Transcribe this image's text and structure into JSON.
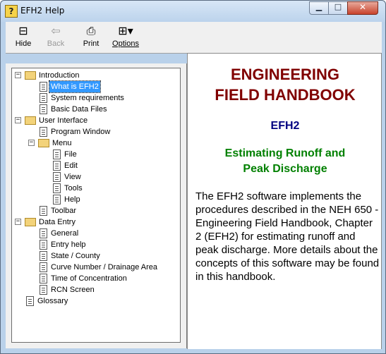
{
  "window": {
    "title": "EFH2 Help"
  },
  "toolbar": {
    "buttons": [
      {
        "label": "Hide",
        "icon": "hide-icon",
        "enabled": true
      },
      {
        "label": "Back",
        "icon": "back-arrow-icon",
        "enabled": false
      },
      {
        "label": "Print",
        "icon": "printer-icon",
        "enabled": true
      },
      {
        "label": "Options",
        "icon": "options-icon",
        "enabled": true
      }
    ]
  },
  "tree": {
    "nodes": [
      {
        "label": "Introduction",
        "type": "folder",
        "expanded": true,
        "level": 0
      },
      {
        "label": "What is EFH2",
        "type": "page",
        "level": 1,
        "selected": true
      },
      {
        "label": "System requirements",
        "type": "page",
        "level": 1
      },
      {
        "label": "Basic Data Files",
        "type": "page",
        "level": 1
      },
      {
        "label": "User Interface",
        "type": "folder",
        "expanded": true,
        "level": 0
      },
      {
        "label": "Program Window",
        "type": "page",
        "level": 1
      },
      {
        "label": "Menu",
        "type": "folder",
        "expanded": true,
        "level": 1
      },
      {
        "label": "File",
        "type": "page",
        "level": 2
      },
      {
        "label": "Edit",
        "type": "page",
        "level": 2
      },
      {
        "label": "View",
        "type": "page",
        "level": 2
      },
      {
        "label": "Tools",
        "type": "page",
        "level": 2
      },
      {
        "label": "Help",
        "type": "page",
        "level": 2
      },
      {
        "label": "Toolbar",
        "type": "page",
        "level": 1
      },
      {
        "label": "Data Entry",
        "type": "folder",
        "expanded": true,
        "level": 0
      },
      {
        "label": "General",
        "type": "page",
        "level": 1
      },
      {
        "label": "Entry help",
        "type": "page",
        "level": 1
      },
      {
        "label": "State / County",
        "type": "page",
        "level": 1
      },
      {
        "label": "Curve Number / Drainage Area",
        "type": "page",
        "level": 1
      },
      {
        "label": "Time of Concentration",
        "type": "page",
        "level": 1
      },
      {
        "label": "RCN Screen",
        "type": "page",
        "level": 1
      },
      {
        "label": "Glossary",
        "type": "page",
        "level": 0
      }
    ]
  },
  "content": {
    "heading_line1": "ENGINEERING",
    "heading_line2": "FIELD HANDBOOK",
    "subtitle": "EFH2",
    "section_line1": "Estimating Runoff and",
    "section_line2": "Peak Discharge",
    "body": "The EFH2 software implements the procedures described in the NEH 650 -Engineering Field Handbook, Chapter 2 (EFH2) for estimating runoff and peak discharge. More details about the concepts of this software may be found in this handbook."
  },
  "colors": {
    "heading": "#800000",
    "subtitle": "#000080",
    "section": "#008000",
    "selection": "#3399ff"
  }
}
